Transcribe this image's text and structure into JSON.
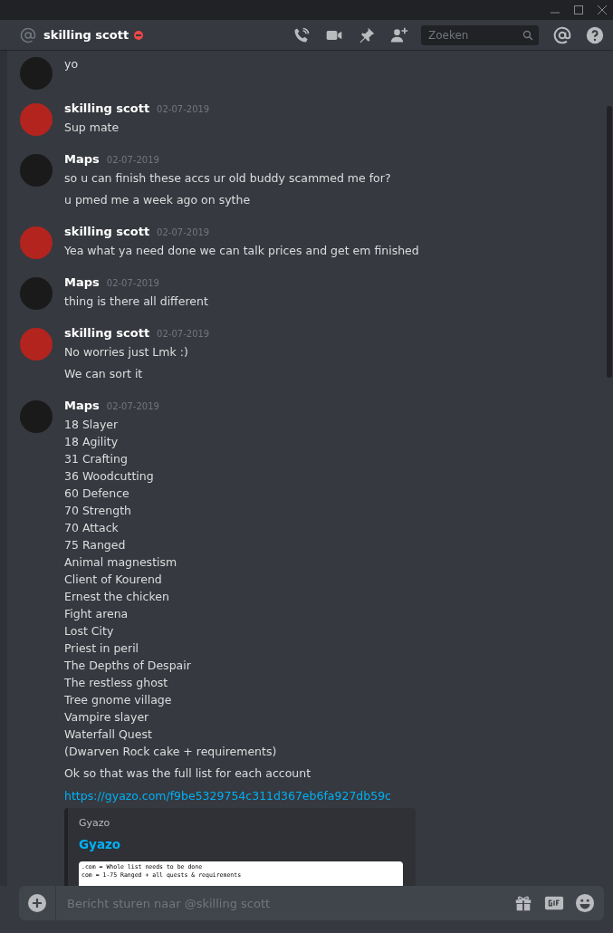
{
  "header": {
    "title": "skilling scott",
    "search": {
      "placeholder": "Zoeken"
    }
  },
  "groups": [
    {
      "color": "#1a1a1a",
      "messages": [
        "yo"
      ]
    },
    {
      "author": "skilling scott",
      "timestamp": "02-07-2019",
      "color": "#b3241f",
      "messages": [
        "Sup mate"
      ]
    },
    {
      "author": "Maps",
      "timestamp": "02-07-2019",
      "color": "#1a1a1a",
      "messages": [
        "so u can finish these accs ur old buddy scammed me for?",
        "u pmed me a week ago on sythe"
      ]
    },
    {
      "author": "skilling scott",
      "timestamp": "02-07-2019",
      "color": "#b3241f",
      "messages": [
        "Yea what ya need done we can talk prices and get em finished"
      ]
    },
    {
      "author": "Maps",
      "timestamp": "02-07-2019",
      "color": "#1a1a1a",
      "messages": [
        "thing is there all different"
      ]
    },
    {
      "author": "skilling scott",
      "timestamp": "02-07-2019",
      "color": "#b3241f",
      "messages": [
        "No worries just Lmk :)",
        "We can sort it"
      ]
    },
    {
      "author": "Maps",
      "timestamp": "02-07-2019",
      "color": "#1a1a1a",
      "messages": [
        "18 Slayer\n18 Agility\n31 Crafting\n36 Woodcutting\n60 Defence\n70 Strength\n70 Attack\n75 Ranged\nAnimal magnestism\nClient of Kourend\nErnest the chicken\nFight arena\nLost City\nPriest in peril\nThe Depths of Despair\nThe restless ghost\nTree gnome village\nVampire slayer\nWaterfall Quest\n(Dwarven Rock cake + requirements)",
        "Ok so that was the full list for each account"
      ],
      "link": "https://gyazo.com/f9be5329754c311d367eb6fa927db59c",
      "embed": {
        "provider": "Gyazo",
        "title": "Gyazo",
        "image_lines": [
          ".com = Whole list needs to be done",
          "com = 1-75 Ranged + all quests & requirements"
        ]
      }
    }
  ],
  "composer": {
    "placeholder": "Bericht sturen naar @skilling scott"
  }
}
